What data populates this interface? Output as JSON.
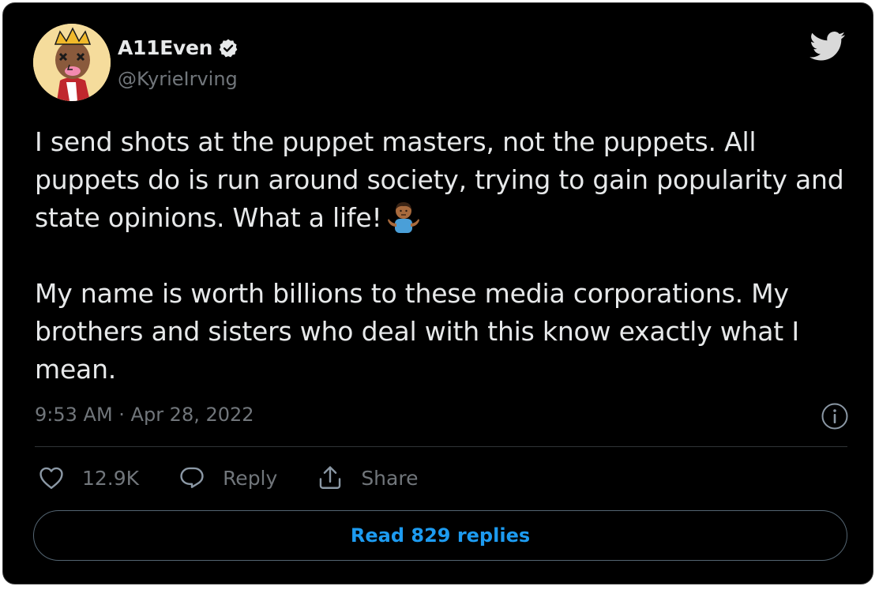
{
  "tweet": {
    "author_name": "A11Even",
    "handle": "@KyrieIrving",
    "paragraphs": [
      "I send shots at the puppet masters, not the puppets. All puppets do is run around society, trying to gain popularity and state opinions.  What a life!",
      "My name is worth billions to these media corporations. My brothers and sisters who deal with this know exactly what I mean."
    ],
    "timestamp": "9:53 AM · Apr 28, 2022"
  },
  "actions": {
    "like_count": "12.9K",
    "reply_label": "Reply",
    "share_label": "Share"
  },
  "read_replies_label": "Read 829 replies",
  "icons": {
    "verified": "verified-badge-icon",
    "brand": "twitter-bird-icon",
    "info": "info-icon",
    "like": "heart-icon",
    "reply": "speech-bubble-icon",
    "share": "share-upload-icon",
    "emoji": "person-shrugging-emoji"
  },
  "colors": {
    "background": "#000000",
    "text": "#e7e9ea",
    "muted": "#71767b",
    "accent": "#1d9bf0"
  }
}
